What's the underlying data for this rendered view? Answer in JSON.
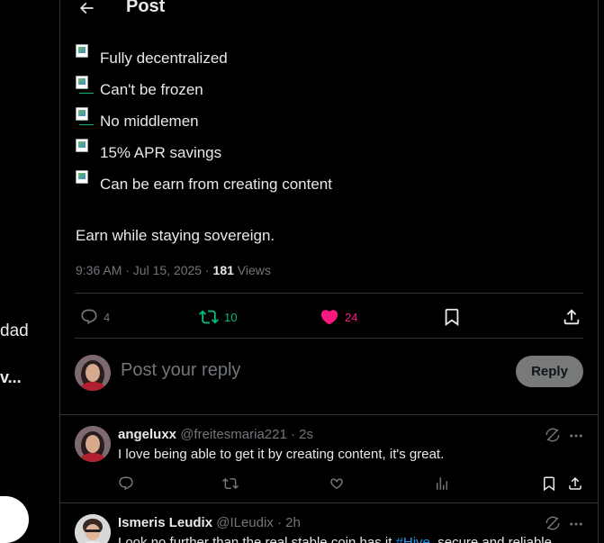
{
  "left": {
    "text1": "dad",
    "text2": "v..."
  },
  "header": {
    "title": "Post"
  },
  "bullets": [
    "Fully decentralized",
    "Can't be frozen",
    "No middlemen",
    "15% APR savings",
    "Can be earn from creating content"
  ],
  "body": "Earn while staying sovereign.",
  "meta": {
    "time": "9:36 AM · Jul 15, 2025 · ",
    "views_count": "181",
    "views_label": " Views"
  },
  "actions": {
    "replies": "4",
    "reposts": "10",
    "likes": "24"
  },
  "colors": {
    "repost": "#00ba7c",
    "like": "#f91880",
    "link": "#1d9bf0"
  },
  "reply": {
    "placeholder": "Post your reply",
    "button": "Reply"
  },
  "replies": [
    {
      "name": "angeluxx",
      "handle": "@freitesmaria221 · 2s",
      "text": "I love being able to get it by creating content, it's great."
    },
    {
      "name": "Ismeris Leudix",
      "handle": "@ILeudix · 2h",
      "text_before": "Look no further than the real stable coin has it ",
      "hashtag": "#Hive",
      "text_after": ", secure and reliable"
    }
  ]
}
